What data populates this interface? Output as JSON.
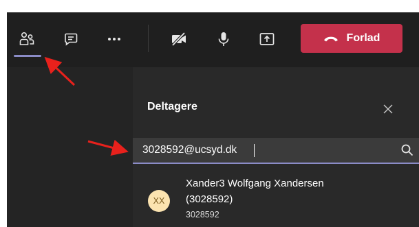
{
  "toolbar": {
    "leave_label": "Forlad",
    "leave_color": "#c4314b",
    "active_indicator_color": "#8b8cc7",
    "icons": [
      "people-icon",
      "chat-icon",
      "more-icon",
      "camera-off-icon",
      "microphone-icon",
      "share-screen-icon",
      "phone-hangup-icon"
    ]
  },
  "panel": {
    "title": "Deltagere",
    "close_icon": "close-icon"
  },
  "search": {
    "value": "3028592@ucsyd.dk",
    "icon": "search-icon"
  },
  "result": {
    "initials": "XX",
    "name": "Xander3 Wolfgang Xandersen",
    "id_line": "(3028592)",
    "subtitle": "3028592",
    "avatar_color": "#fbe3b0"
  },
  "annotations": {
    "arrow_color": "#e8211c"
  }
}
